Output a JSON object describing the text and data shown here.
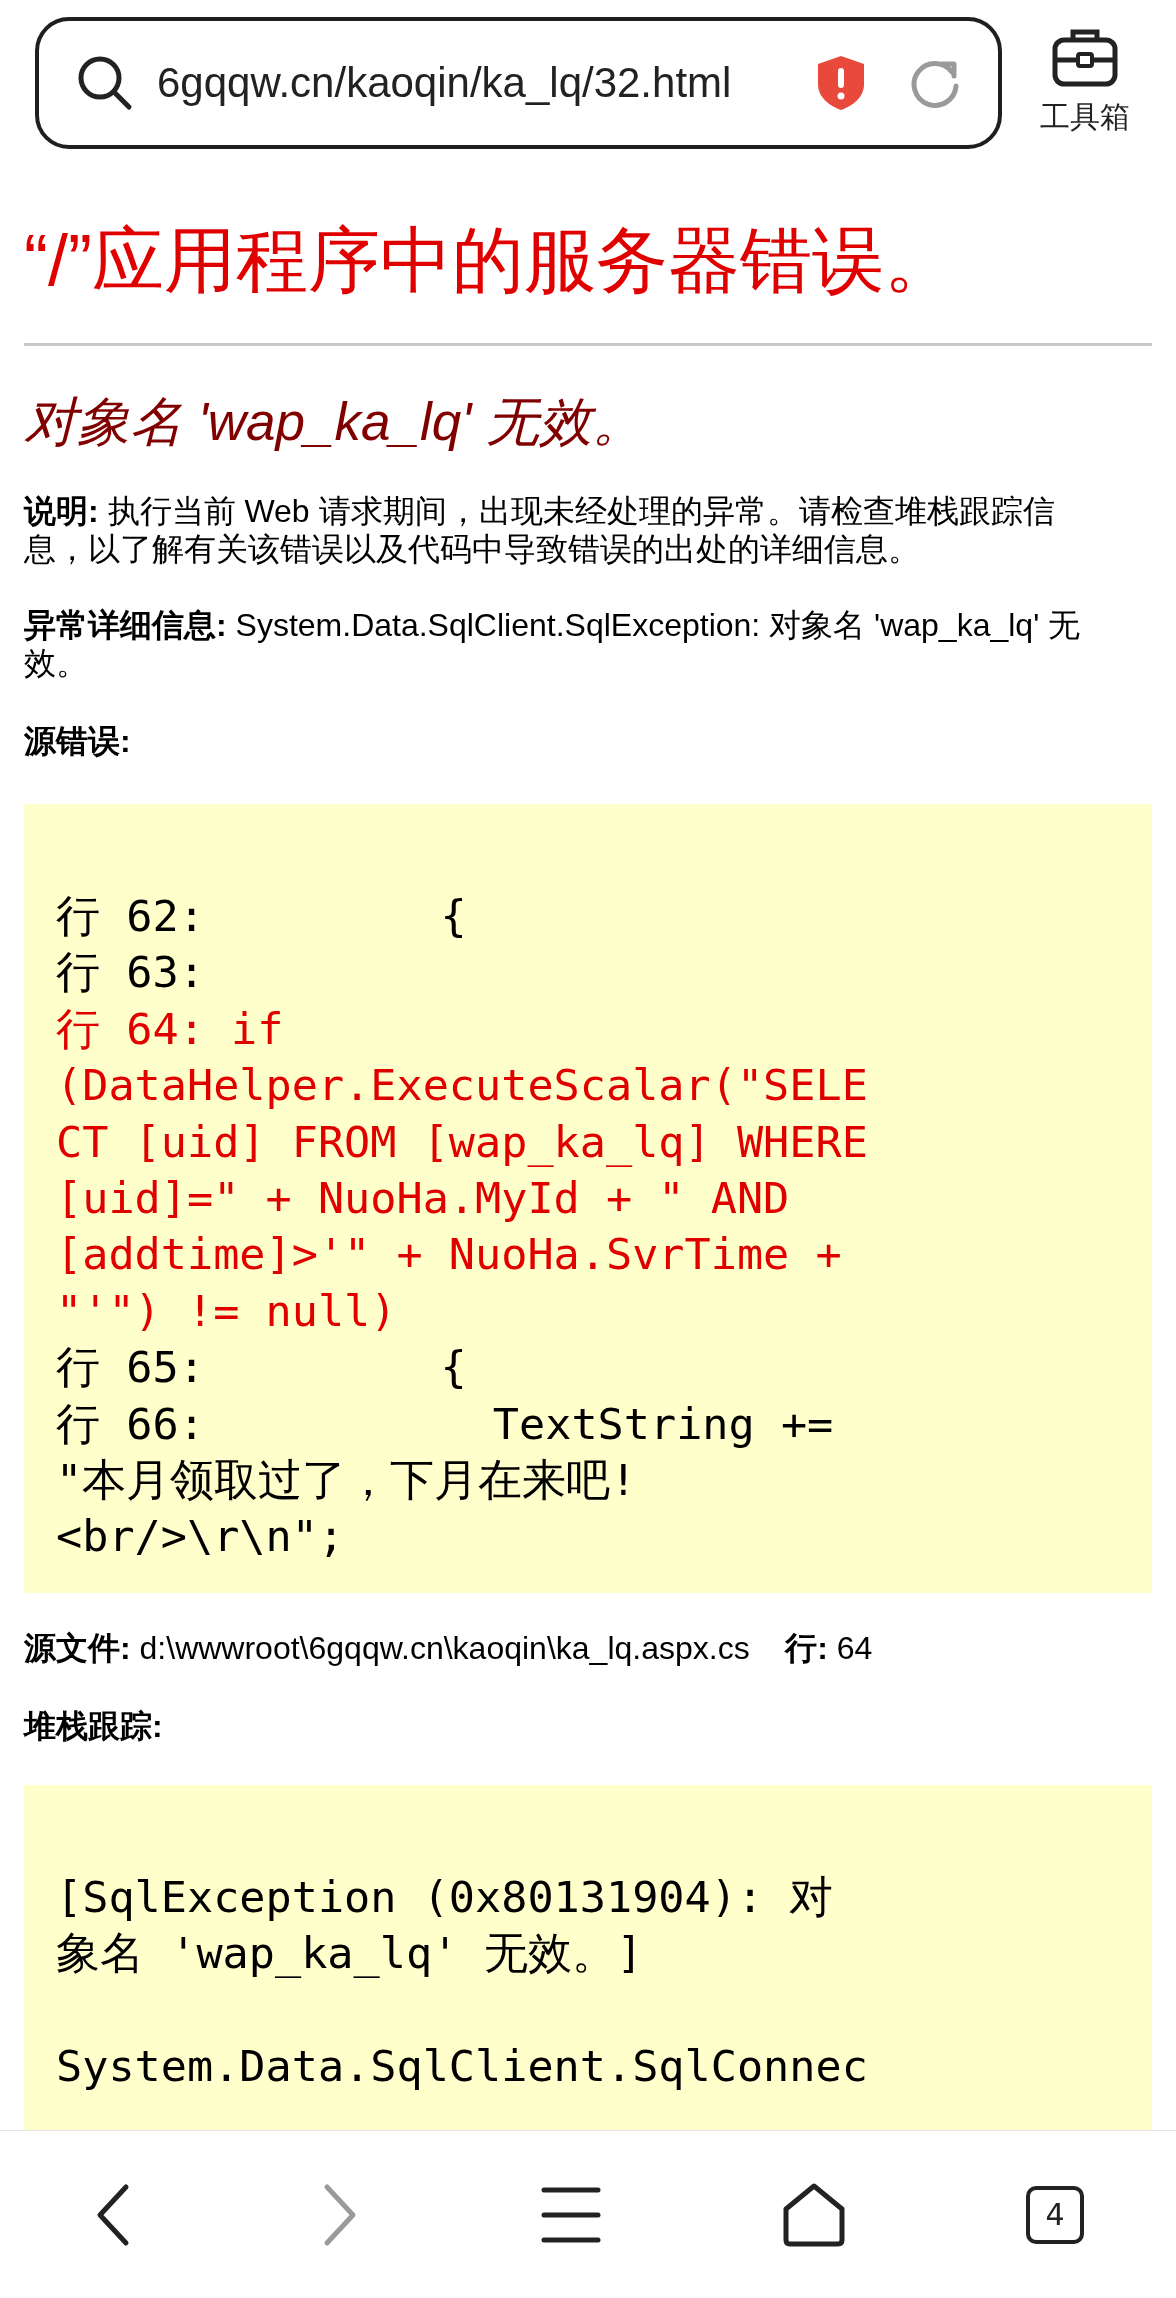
{
  "address_bar": {
    "url": "6gqqw.cn/kaoqin/ka_lq/32.html"
  },
  "toolbox": {
    "label": "工具箱"
  },
  "page": {
    "title": "“/”应用程序中的服务器错误。",
    "subtitle": "对象名 'wap_ka_lq' 无效。",
    "description": "**说明:** 执行当前 Web 请求期间，出现未经处理的异常。请检查堆栈跟踪信息，以了解有关该错误以及代码中导致错误的出处的详细信息。",
    "exception_details": "**异常详细信息:** System.Data.SqlClient.SqlException: 对象名 'wap_ka_lq' 无效。",
    "source_error": {
      "label": "源错误:",
      "lines": [
        {
          "text": "行 62:         {",
          "highlighted": false
        },
        {
          "text": "行 63:",
          "highlighted": false
        },
        {
          "text": "行 64: if (DataHelper.ExecuteScalar(\"SELECT [uid] FROM [wap_ka_lq] WHERE [uid]=\" + NuoHa.MyId + \" AND [addtime]>'\" + NuoHa.SvrTime + \"'\") != null)",
          "highlighted": true
        },
        {
          "text": "行 65:         {",
          "highlighted": false
        },
        {
          "text": "行 66:           TextString += \"本月领取过了，下月在来吧!<br/>\\r\\n\";",
          "highlighted": false
        }
      ]
    },
    "source_file": "**源文件:** d:\\wwwroot\\6gqqw.cn\\kaoqin\\ka_lq.aspx.cs    **行:** 64",
    "stack_trace": {
      "label": "堆栈跟踪:",
      "blocks": [
        "[SqlException (0x80131904): 对象名 'wap_ka_lq' 无效。]",
        "System.Data.SqlClient.SqlConnec"
      ]
    }
  },
  "bottom_nav": {
    "tabs_count": "4",
    "forward_disabled": true
  }
}
